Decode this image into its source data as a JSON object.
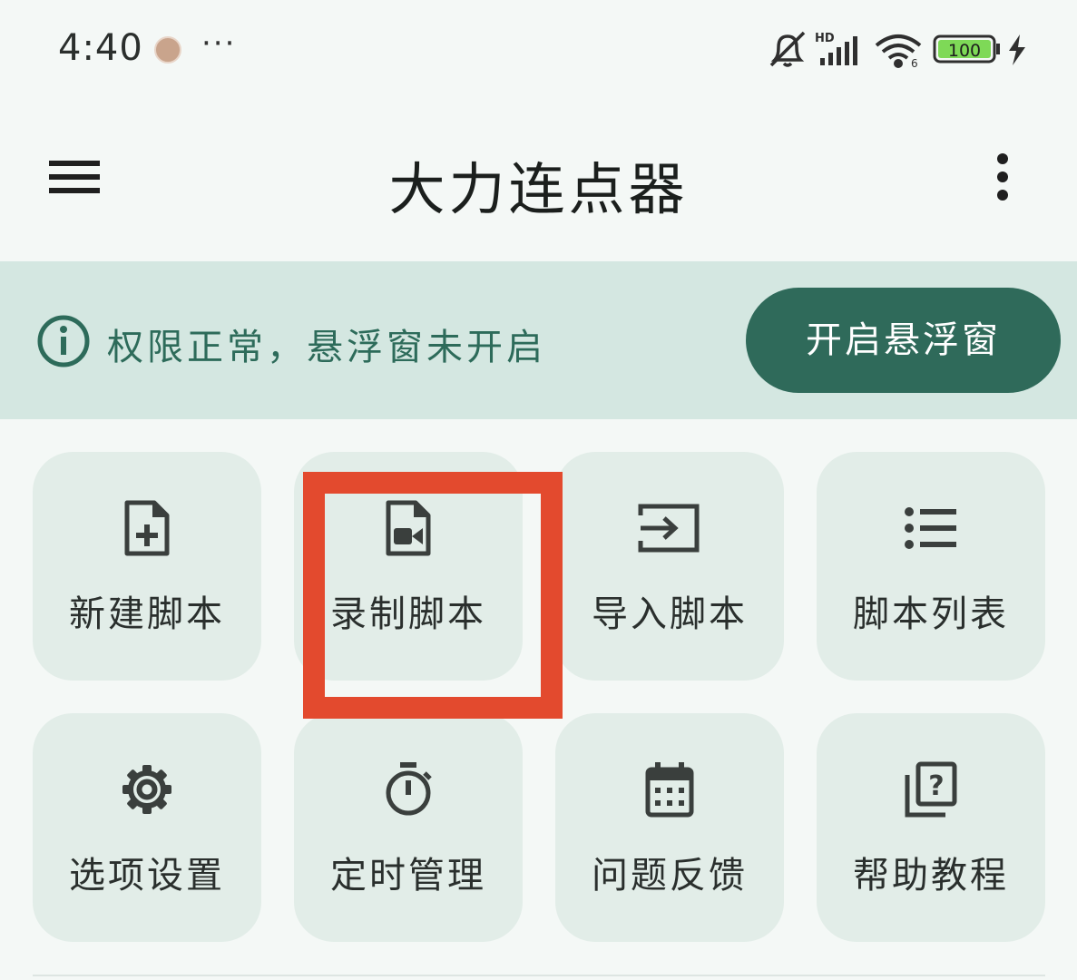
{
  "status_bar": {
    "time": "4:40",
    "overflow": "···",
    "battery": "100",
    "icons": [
      "notification-avatar",
      "dnd-bell-off-icon",
      "hd-signal-icon",
      "wifi-6-icon",
      "battery-icon",
      "charging-bolt-icon"
    ]
  },
  "app_bar": {
    "title": "大力连点器",
    "menu_icon": "hamburger-menu-icon",
    "more_icon": "more-vertical-icon"
  },
  "banner": {
    "message": "权限正常，悬浮窗未开启",
    "button_label": "开启悬浮窗",
    "icon": "info-icon",
    "bg_color": "#d4e7e1",
    "accent_color": "#2f6a5a"
  },
  "tiles": [
    {
      "label": "新建脚本",
      "icon": "new-file-plus-icon"
    },
    {
      "label": "录制脚本",
      "icon": "video-file-icon"
    },
    {
      "label": "导入脚本",
      "icon": "import-icon"
    },
    {
      "label": "脚本列表",
      "icon": "list-icon"
    },
    {
      "label": "选项设置",
      "icon": "gear-icon"
    },
    {
      "label": "定时管理",
      "icon": "stopwatch-icon"
    },
    {
      "label": "问题反馈",
      "icon": "calendar-icon"
    },
    {
      "label": "帮助教程",
      "icon": "help-library-icon"
    }
  ],
  "highlight": {
    "target": "录制脚本",
    "color": "#e34a2e"
  }
}
